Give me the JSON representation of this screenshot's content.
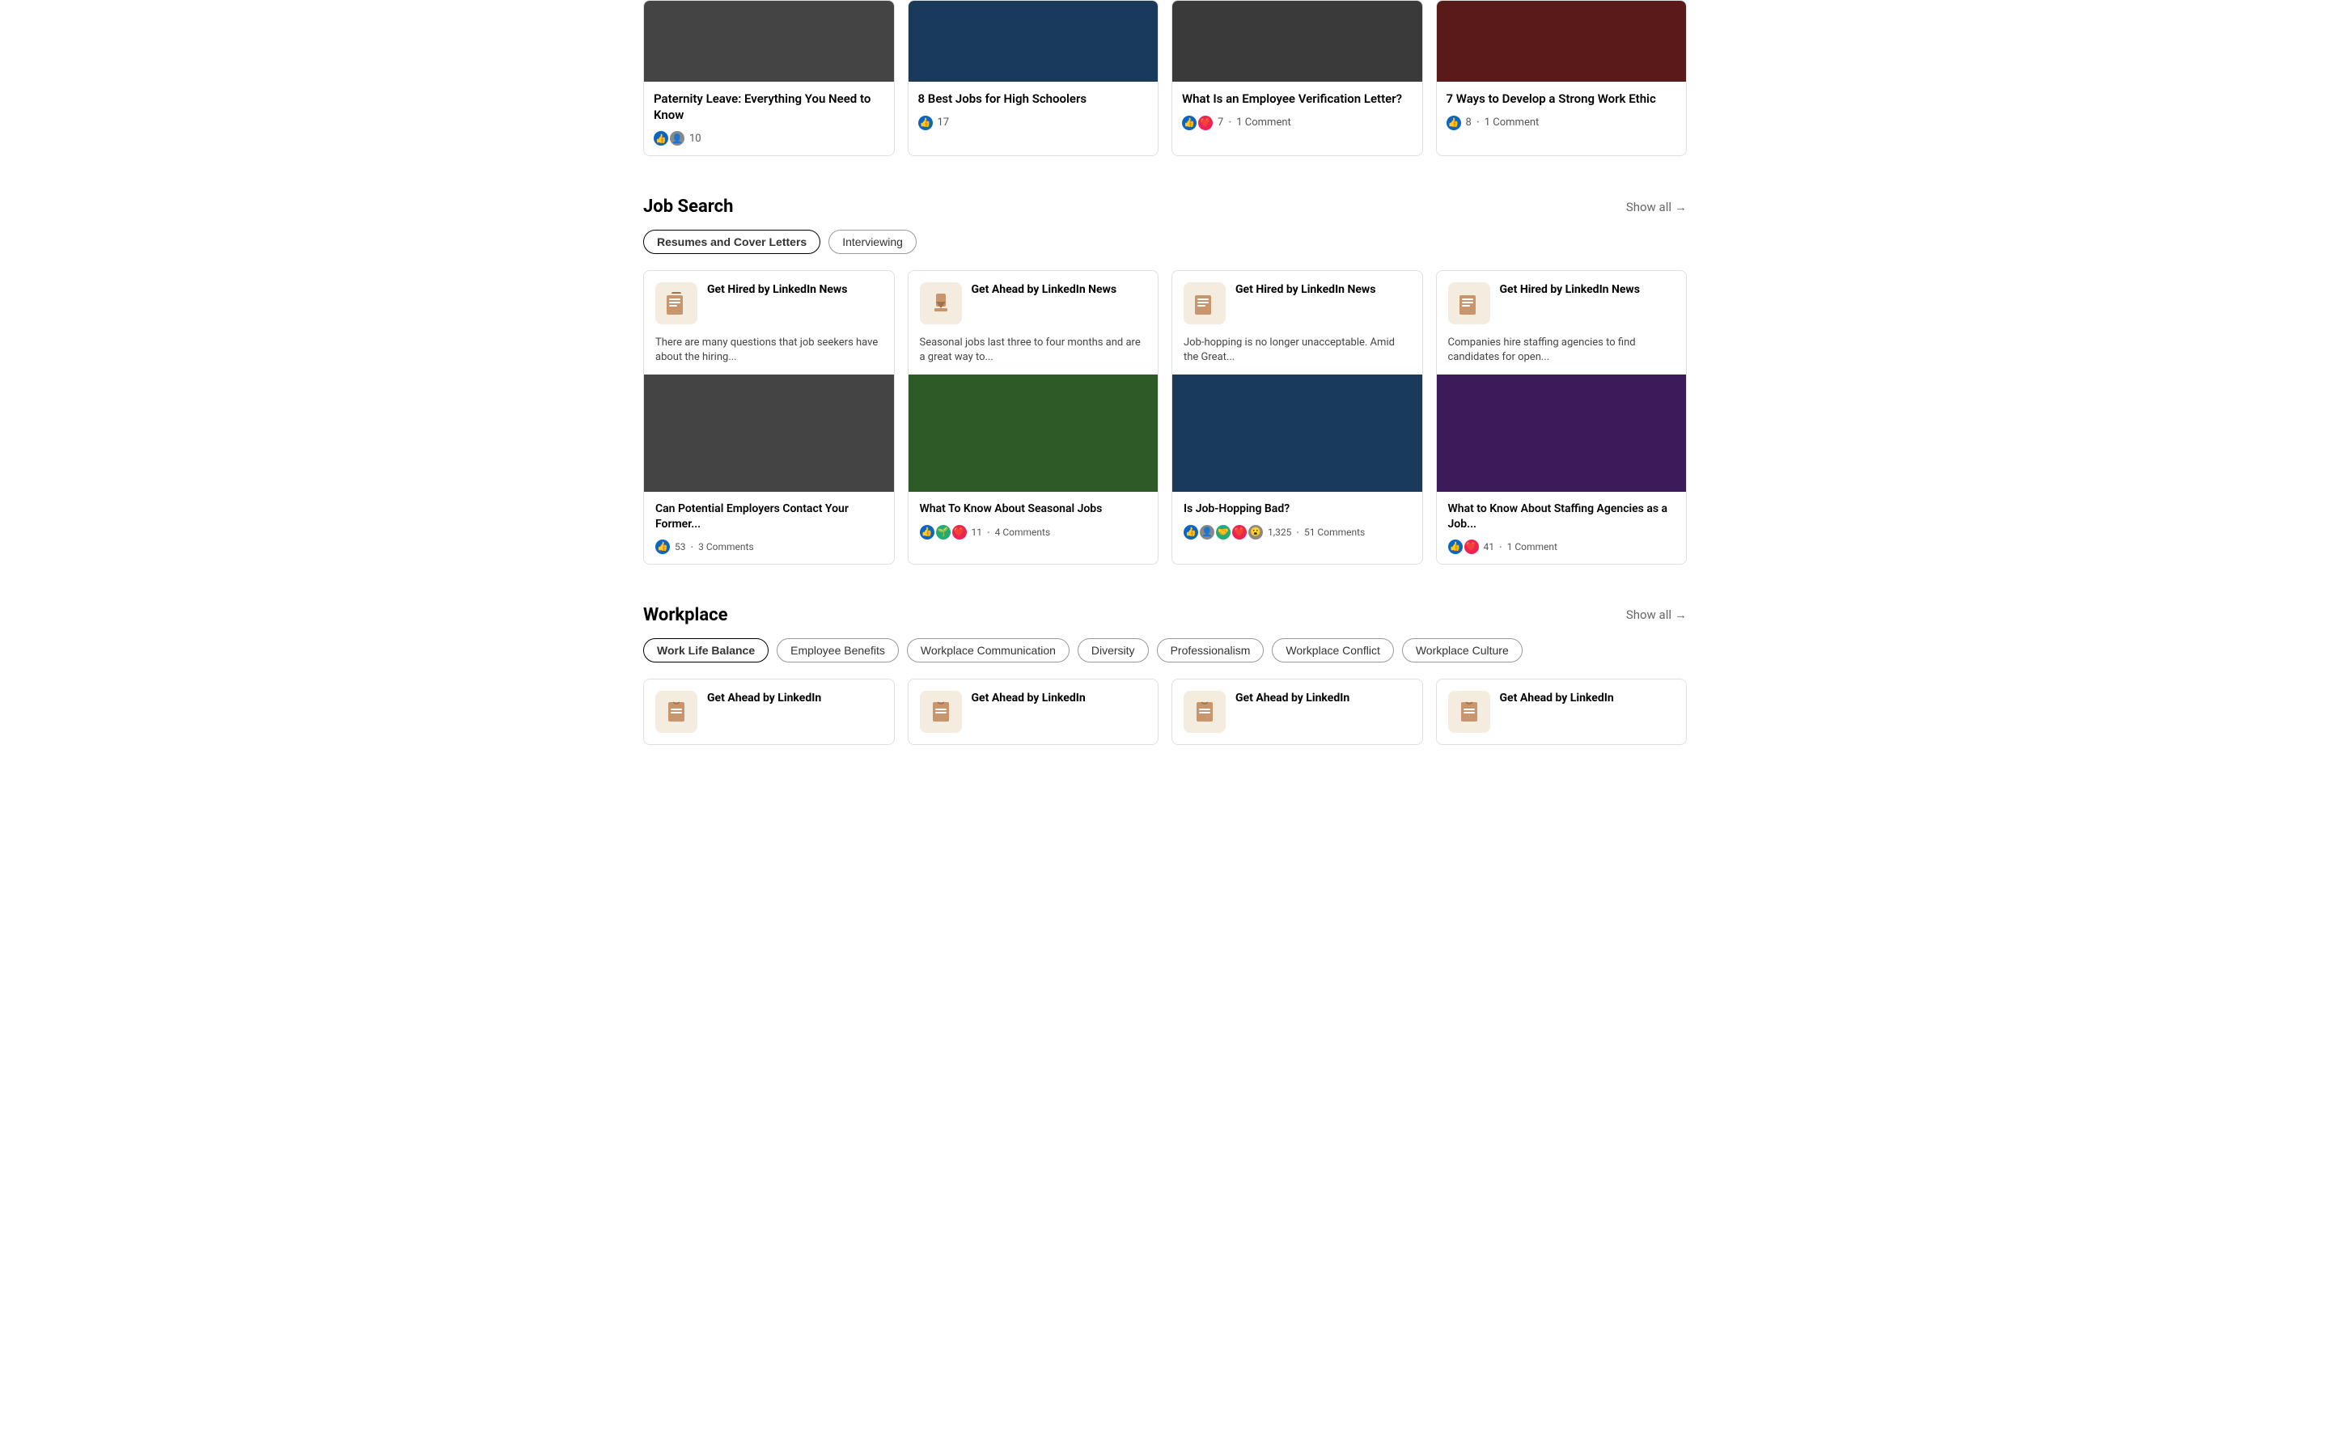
{
  "topCards": [
    {
      "title": "Paternity Leave: Everything You Need to Know",
      "reactions": [
        "👍",
        "👤"
      ],
      "count": "10",
      "imgClass": "img-dark"
    },
    {
      "title": "8 Best Jobs for High Schoolers",
      "reactions": [
        "👍"
      ],
      "count": "17",
      "imgClass": "img-blue-dark"
    },
    {
      "title": "What Is an Employee Verification Letter?",
      "reactions": [
        "👍",
        "❤️"
      ],
      "count": "7",
      "comment": "1 Comment",
      "imgClass": "img-gray-dark"
    },
    {
      "title": "7 Ways to Develop a Strong Work Ethic",
      "reactions": [
        "👍"
      ],
      "count": "8",
      "comment": "1 Comment",
      "imgClass": "img-red-dark"
    }
  ],
  "jobSearch": {
    "sectionTitle": "Job Search",
    "showAllLabel": "Show all",
    "filters": [
      "Resumes and Cover Letters",
      "Interviewing"
    ],
    "articles": [
      {
        "sourceTitle": "Get Hired by LinkedIn News",
        "desc": "There are many questions that job seekers have about the hiring...",
        "cardTitle": "Can Potential Employers Contact Your Former...",
        "reactions": [
          "👍"
        ],
        "count": "53",
        "comment": "3 Comments",
        "imgClass": "img-dark"
      },
      {
        "sourceTitle": "Get Ahead by LinkedIn News",
        "desc": "Seasonal jobs last three to four months and are a great way to...",
        "cardTitle": "What To Know About Seasonal Jobs",
        "reactions": [
          "👍",
          "🌱",
          "❤️"
        ],
        "count": "11",
        "comment": "4 Comments",
        "imgClass": "img-green"
      },
      {
        "sourceTitle": "Get Hired by LinkedIn News",
        "desc": "Job-hopping is no longer unacceptable. Amid the Great...",
        "cardTitle": "Is Job-Hopping Bad?",
        "reactions": [
          "👍",
          "👤",
          "🤝",
          "❤️",
          "😮"
        ],
        "count": "1,325",
        "comment": "51 Comments",
        "imgClass": "img-blue-dark"
      },
      {
        "sourceTitle": "Get Hired by LinkedIn News",
        "desc": "Companies hire staffing agencies to find candidates for open...",
        "cardTitle": "What to Know About Staffing Agencies as a Job...",
        "reactions": [
          "👍",
          "❤️"
        ],
        "count": "41",
        "comment": "1 Comment",
        "imgClass": "img-purple"
      }
    ]
  },
  "workplace": {
    "sectionTitle": "Workplace",
    "showAllLabel": "Show all",
    "filters": [
      "Work Life Balance",
      "Employee Benefits",
      "Workplace Communication",
      "Diversity",
      "Professionalism",
      "Workplace Conflict",
      "Workplace Culture"
    ],
    "articles": [
      {
        "sourceTitle": "Get Ahead by LinkedIn",
        "imgClass": "img-dark"
      },
      {
        "sourceTitle": "Get Ahead by LinkedIn",
        "imgClass": "img-blue-dark"
      },
      {
        "sourceTitle": "Get Ahead by LinkedIn",
        "imgClass": "img-green"
      },
      {
        "sourceTitle": "Get Ahead by LinkedIn",
        "imgClass": "img-gray-dark"
      }
    ]
  },
  "icons": {
    "thumbsUp": "👍",
    "heart": "❤️",
    "people": "👥",
    "arrow": "→"
  }
}
